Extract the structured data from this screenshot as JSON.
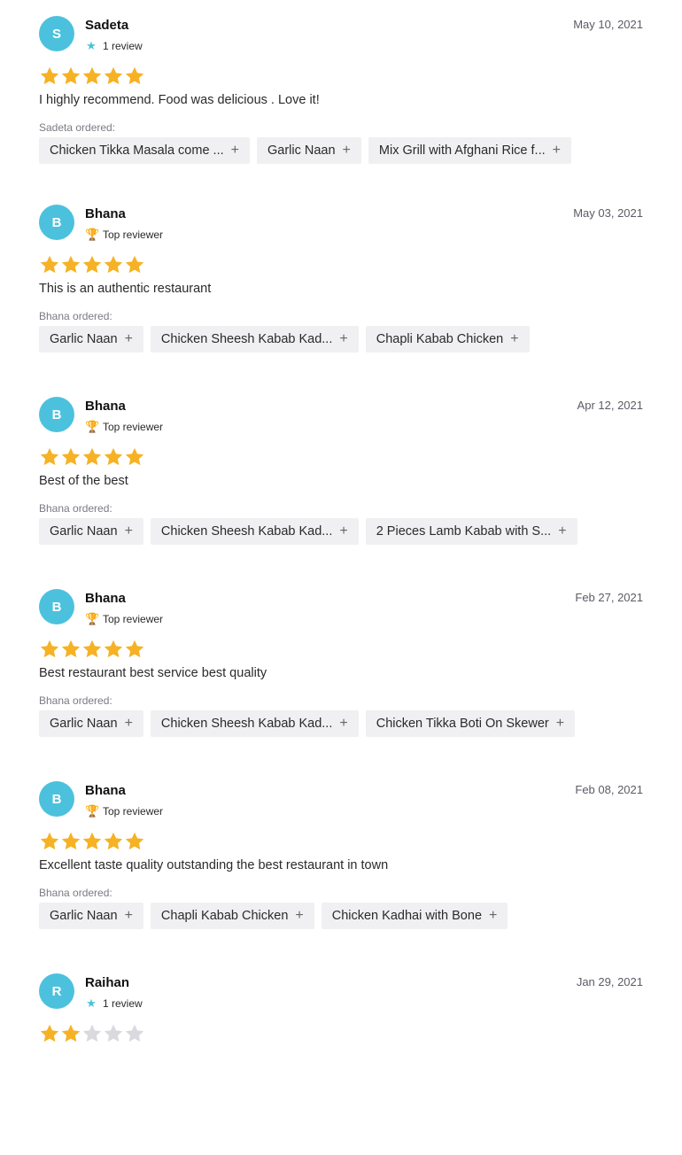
{
  "colors": {
    "avatar": "#4cc1dd",
    "star_filled": "#f6b224",
    "star_empty": "#d9d9de",
    "chip_bg": "#f0f0f2"
  },
  "reviews": [
    {
      "initial": "S",
      "name": "Sadeta",
      "badge_icon": "star-icon",
      "badge_text": "1 review",
      "date": "May 10, 2021",
      "rating": 5,
      "text": "I highly recommend. Food was delicious . Love it!",
      "ordered_label": "Sadeta ordered:",
      "items": [
        "Chicken Tikka Masala come ...",
        "Garlic Naan",
        "Mix Grill with Afghani Rice f..."
      ]
    },
    {
      "initial": "B",
      "name": "Bhana",
      "badge_icon": "trophy-icon",
      "badge_text": "Top reviewer",
      "date": "May 03, 2021",
      "rating": 5,
      "text": "This is an authentic restaurant",
      "ordered_label": "Bhana ordered:",
      "items": [
        "Garlic Naan",
        "Chicken Sheesh Kabab Kad...",
        "Chapli Kabab Chicken"
      ]
    },
    {
      "initial": "B",
      "name": "Bhana",
      "badge_icon": "trophy-icon",
      "badge_text": "Top reviewer",
      "date": "Apr 12, 2021",
      "rating": 5,
      "text": "Best of the best",
      "ordered_label": "Bhana ordered:",
      "items": [
        "Garlic Naan",
        "Chicken Sheesh Kabab Kad...",
        "2 Pieces Lamb Kabab with S..."
      ]
    },
    {
      "initial": "B",
      "name": "Bhana",
      "badge_icon": "trophy-icon",
      "badge_text": "Top reviewer",
      "date": "Feb 27, 2021",
      "rating": 5,
      "text": "Best restaurant best service best quality",
      "ordered_label": "Bhana ordered:",
      "items": [
        "Garlic Naan",
        "Chicken Sheesh Kabab Kad...",
        "Chicken Tikka Boti On Skewer"
      ]
    },
    {
      "initial": "B",
      "name": "Bhana",
      "badge_icon": "trophy-icon",
      "badge_text": "Top reviewer",
      "date": "Feb 08, 2021",
      "rating": 5,
      "text": "Excellent taste quality outstanding the best restaurant in town",
      "ordered_label": "Bhana ordered:",
      "items": [
        "Garlic Naan",
        "Chapli Kabab Chicken",
        "Chicken Kadhai with Bone"
      ]
    },
    {
      "initial": "R",
      "name": "Raihan",
      "badge_icon": "star-icon",
      "badge_text": "1 review",
      "date": "Jan 29, 2021",
      "rating": 2,
      "text": "",
      "ordered_label": "",
      "items": []
    }
  ]
}
